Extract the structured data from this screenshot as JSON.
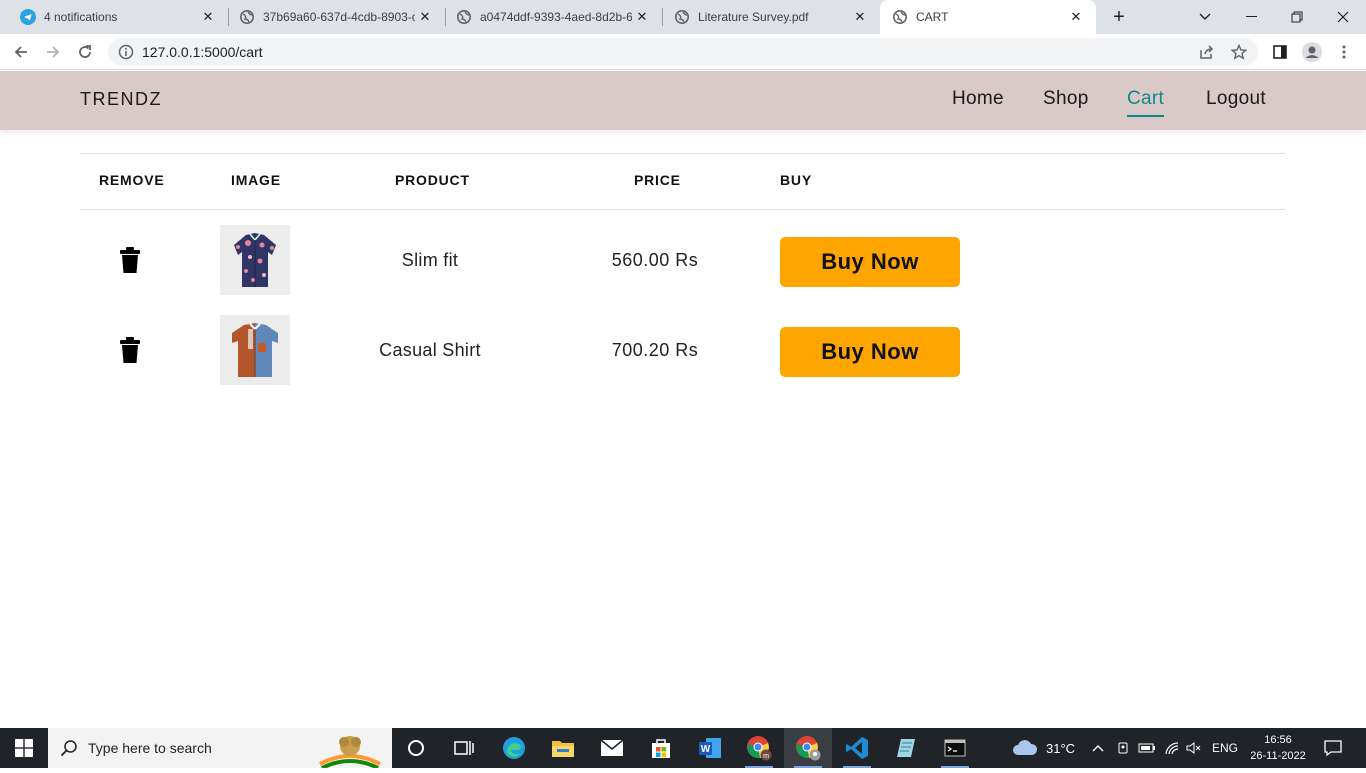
{
  "browser": {
    "tabs": [
      {
        "title": "4 notifications",
        "icon": "telegram-icon"
      },
      {
        "title": "37b69a60-637d-4cdb-8903-c",
        "icon": "globe-icon"
      },
      {
        "title": "a0474ddf-9393-4aed-8d2b-6",
        "icon": "globe-icon"
      },
      {
        "title": "Literature Survey.pdf",
        "icon": "globe-icon"
      },
      {
        "title": "CART",
        "icon": "globe-icon",
        "active": true
      }
    ],
    "url": "127.0.0.1:5000/cart"
  },
  "site": {
    "brand": "TRENDZ",
    "nav": [
      {
        "label": "Home"
      },
      {
        "label": "Shop"
      },
      {
        "label": "Cart",
        "active": true
      },
      {
        "label": "Logout"
      }
    ],
    "accent_color": "#0e8a86",
    "header_bg": "#d9c9c9"
  },
  "cart": {
    "headers": {
      "remove": "REMOVE",
      "image": "IMAGE",
      "product": "PRODUCT",
      "price": "PRICE",
      "buy": "BUY"
    },
    "items": [
      {
        "product": "Slim fit",
        "price": "560.00 Rs",
        "buy_label": "Buy Now",
        "image": "floral-navy-shirt"
      },
      {
        "product": "Casual Shirt",
        "price": "700.20 Rs",
        "buy_label": "Buy Now",
        "image": "rust-denim-shirt"
      }
    ],
    "button_color": "#ffa500"
  },
  "taskbar": {
    "search_placeholder": "Type here to search",
    "weather": "31°C",
    "language": "ENG",
    "time": "16:56",
    "date": "26-11-2022"
  }
}
